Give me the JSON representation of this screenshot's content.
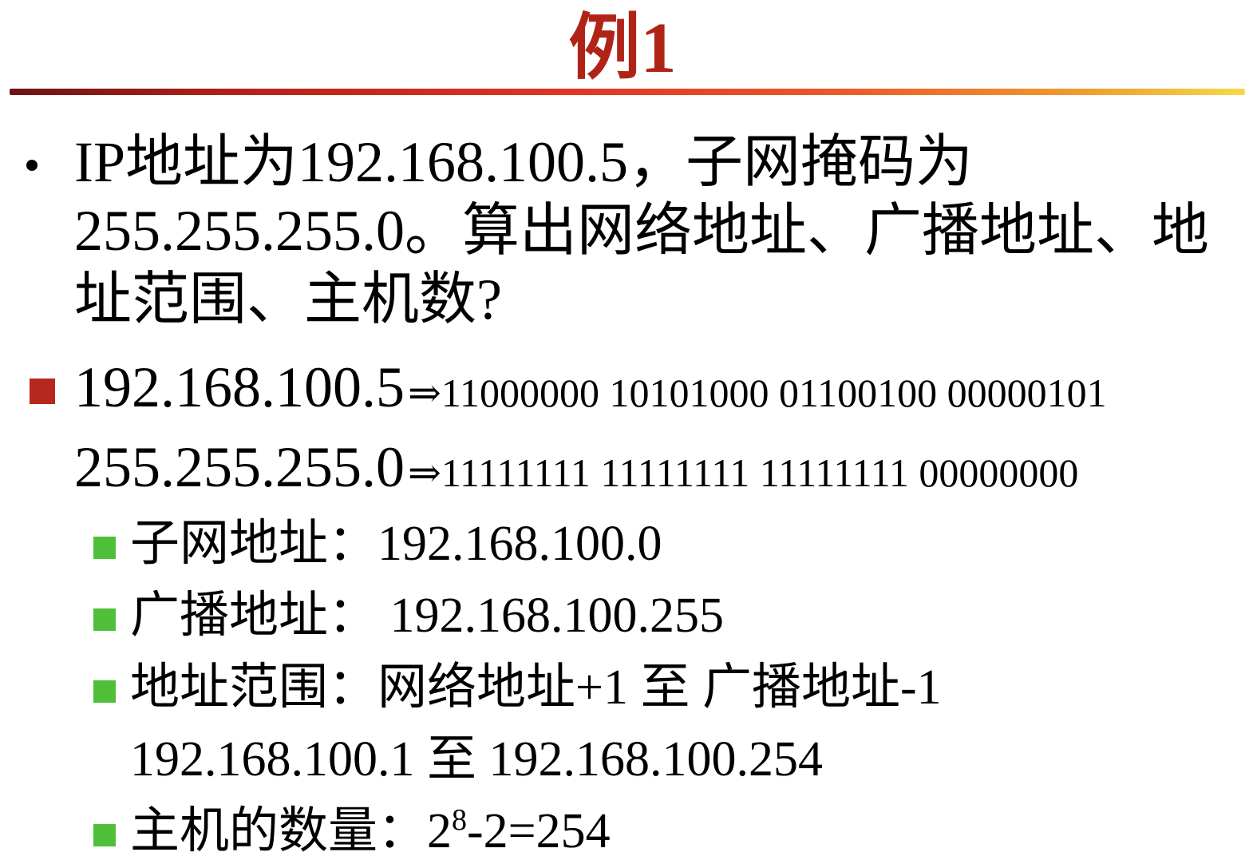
{
  "title": "例1",
  "question": {
    "line1": "IP地址为192.168.100.5，子网掩码为",
    "line2": "255.255.255.0。算出网络地址、广播地址、地",
    "line3": "址范围、主机数?"
  },
  "binary": {
    "ip": "192.168.100.5",
    "ip_bits": "⇒11000000 10101000 01100100 00000101",
    "mask": "255.255.255.0",
    "mask_bits": "⇒11111111  11111111  11111111  00000000"
  },
  "answers": {
    "subnet": "子网地址：192.168.100.0",
    "broadcast": "广播地址： 192.168.100.255",
    "range": "地址范围：网络地址+1  至 广播地址-1",
    "range_values": "192.168.100.1 至 192.168.100.254",
    "hosts_label": "主机的数量：2",
    "hosts_exp": "8",
    "hosts_rest": "-2=254"
  },
  "colors": {
    "title": "#b02418",
    "red_bullet": "#b6271e",
    "green_bullet": "#4fbf3a"
  }
}
